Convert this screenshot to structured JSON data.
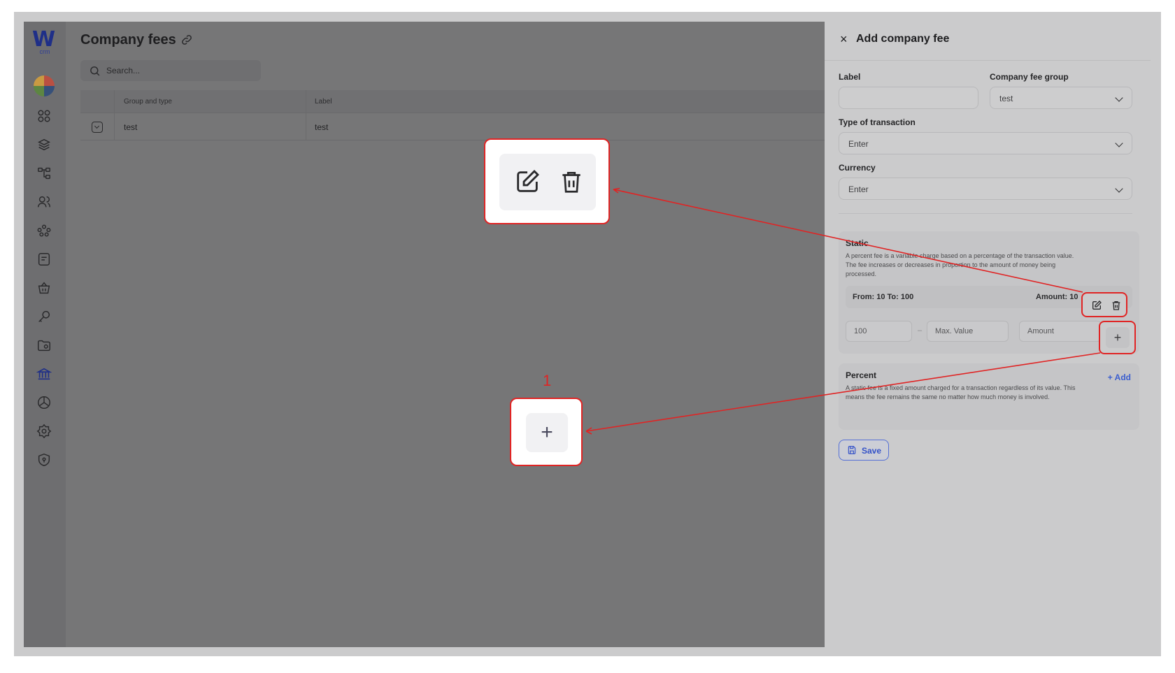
{
  "app": {
    "logo_letter": "W",
    "logo_sub": "crm",
    "page_title": "Company fees",
    "search_placeholder": "Search..."
  },
  "nav": {
    "icons": [
      "dashboard-icon",
      "layers-icon",
      "hierarchy-icon",
      "users-icon",
      "team-icon",
      "invoice-icon",
      "basket-icon",
      "key-icon",
      "folder-icon",
      "bank-icon",
      "cube-icon",
      "settings-icon",
      "shield-icon"
    ],
    "active": "bank-icon"
  },
  "table": {
    "columns": [
      "Group and type",
      "Label"
    ],
    "rows": [
      {
        "group": "test",
        "label": "test"
      }
    ]
  },
  "panel": {
    "title": "Add company fee",
    "label_label": "Label",
    "label_value": "",
    "group_label": "Company fee group",
    "group_value": "test",
    "type_label": "Type of transaction",
    "type_placeholder": "Enter",
    "currency_label": "Currency",
    "currency_placeholder": "Enter",
    "static": {
      "title": "Static",
      "description": "A percent fee is a variable charge based on a percentage of the transaction value. The fee increases or decreases in proportion to the amount of money being processed.",
      "range_text": "From: 10 To: 100",
      "amount_text": "Amount: 10",
      "min_value": "100",
      "max_placeholder": "Max. Value",
      "amount_placeholder": "Amount",
      "separator": "–"
    },
    "percent": {
      "title": "Percent",
      "add_label": "Add",
      "description": "A static fee is a fixed amount charged for a transaction regardless of its value. This means the fee remains the same no matter how much money is involved."
    },
    "save_label": "Save"
  },
  "callouts": {
    "number": "1"
  },
  "colors": {
    "accent": "#3b5ecf",
    "highlight": "#e02424",
    "overlay": "#767677"
  }
}
